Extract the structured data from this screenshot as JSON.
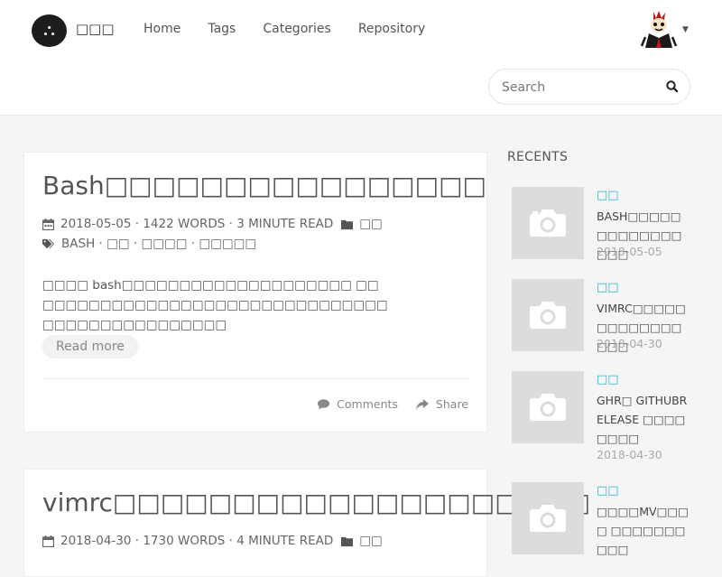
{
  "site": {
    "logo_glyph": "⛬",
    "name": "□□□"
  },
  "nav": {
    "items": [
      "Home",
      "Tags",
      "Categories",
      "Repository"
    ]
  },
  "search": {
    "placeholder": "Search"
  },
  "posts": [
    {
      "title": "Bash□□□□□□□□□□□□□□□□",
      "date": "2018-05-05",
      "words": "1422 WORDS",
      "read_time": "3 MINUTE READ",
      "category": "□□",
      "tags": "BASH · □□ · □□□□ · □□□□□",
      "excerpt": "□□□□ bash□□□□□□□□□□□□□□□□□□□□ □□ □□□□□□□□□□□□□□□□□□□□□□□□□□□□□□ □□□□□□□□□□□□□□□□",
      "read_more": "Read more",
      "comments": "Comments",
      "share": "Share"
    },
    {
      "title": "vimrc□□□□□□□□□□□□□□□□□□□□",
      "date": "2018-04-30",
      "words": "1730 WORDS",
      "read_time": "4 MINUTE READ",
      "category": "□□"
    }
  ],
  "sidebar": {
    "recents_title": "RECENTS",
    "items": [
      {
        "category": "□□",
        "title": "BASH□□□□□□□□□□□□□□□□",
        "date": "2018-05-05"
      },
      {
        "category": "□□",
        "title": "VIMRC□□□□□□□□□□□□□□□□",
        "date": "2018-04-30"
      },
      {
        "category": "□□",
        "title": "GHR□ GITHUBRELEASE □□□□□□□□",
        "date": "2018-04-30"
      },
      {
        "category": "□□",
        "title": "□□□□MV□□□□ □□□□□□□□□□",
        "date": ""
      }
    ]
  },
  "colors": {
    "accent": "#2bb4d3",
    "background": "#f4f5f5",
    "thumb": "#dcdcdc"
  }
}
